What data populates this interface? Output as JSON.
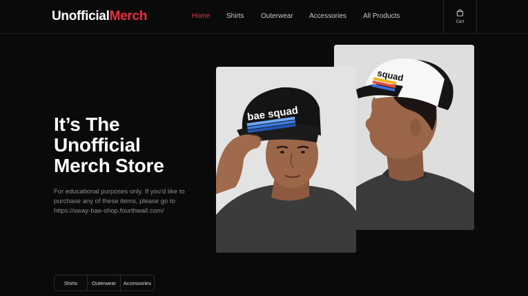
{
  "header": {
    "logo_part1": "Unofficial",
    "logo_part2": "Merch",
    "nav": [
      {
        "label": "Home",
        "active": true
      },
      {
        "label": "Shirts",
        "active": false
      },
      {
        "label": "Outerwear",
        "active": false
      },
      {
        "label": "Accessories",
        "active": false
      },
      {
        "label": "All Products",
        "active": false
      }
    ],
    "cart_label": "Cart",
    "cart_icon": "shopping-bag-icon"
  },
  "hero": {
    "title_line1": "It’s The",
    "title_line2": "Unofficial",
    "title_line3": "Merch Store",
    "description": "For educational purposes only. If you'd like to purchase any of these items, please go to https://sway-bae-shop.fourthwall.com/"
  },
  "categories": [
    "Shirts",
    "Outerwear",
    "Accessories"
  ],
  "products": [
    {
      "hat_text": "bae squad"
    },
    {
      "hat_text": "squad"
    }
  ],
  "colors": {
    "background": "#0b0a0a",
    "accent": "#e8303f",
    "text_muted": "#8e8e8e"
  }
}
